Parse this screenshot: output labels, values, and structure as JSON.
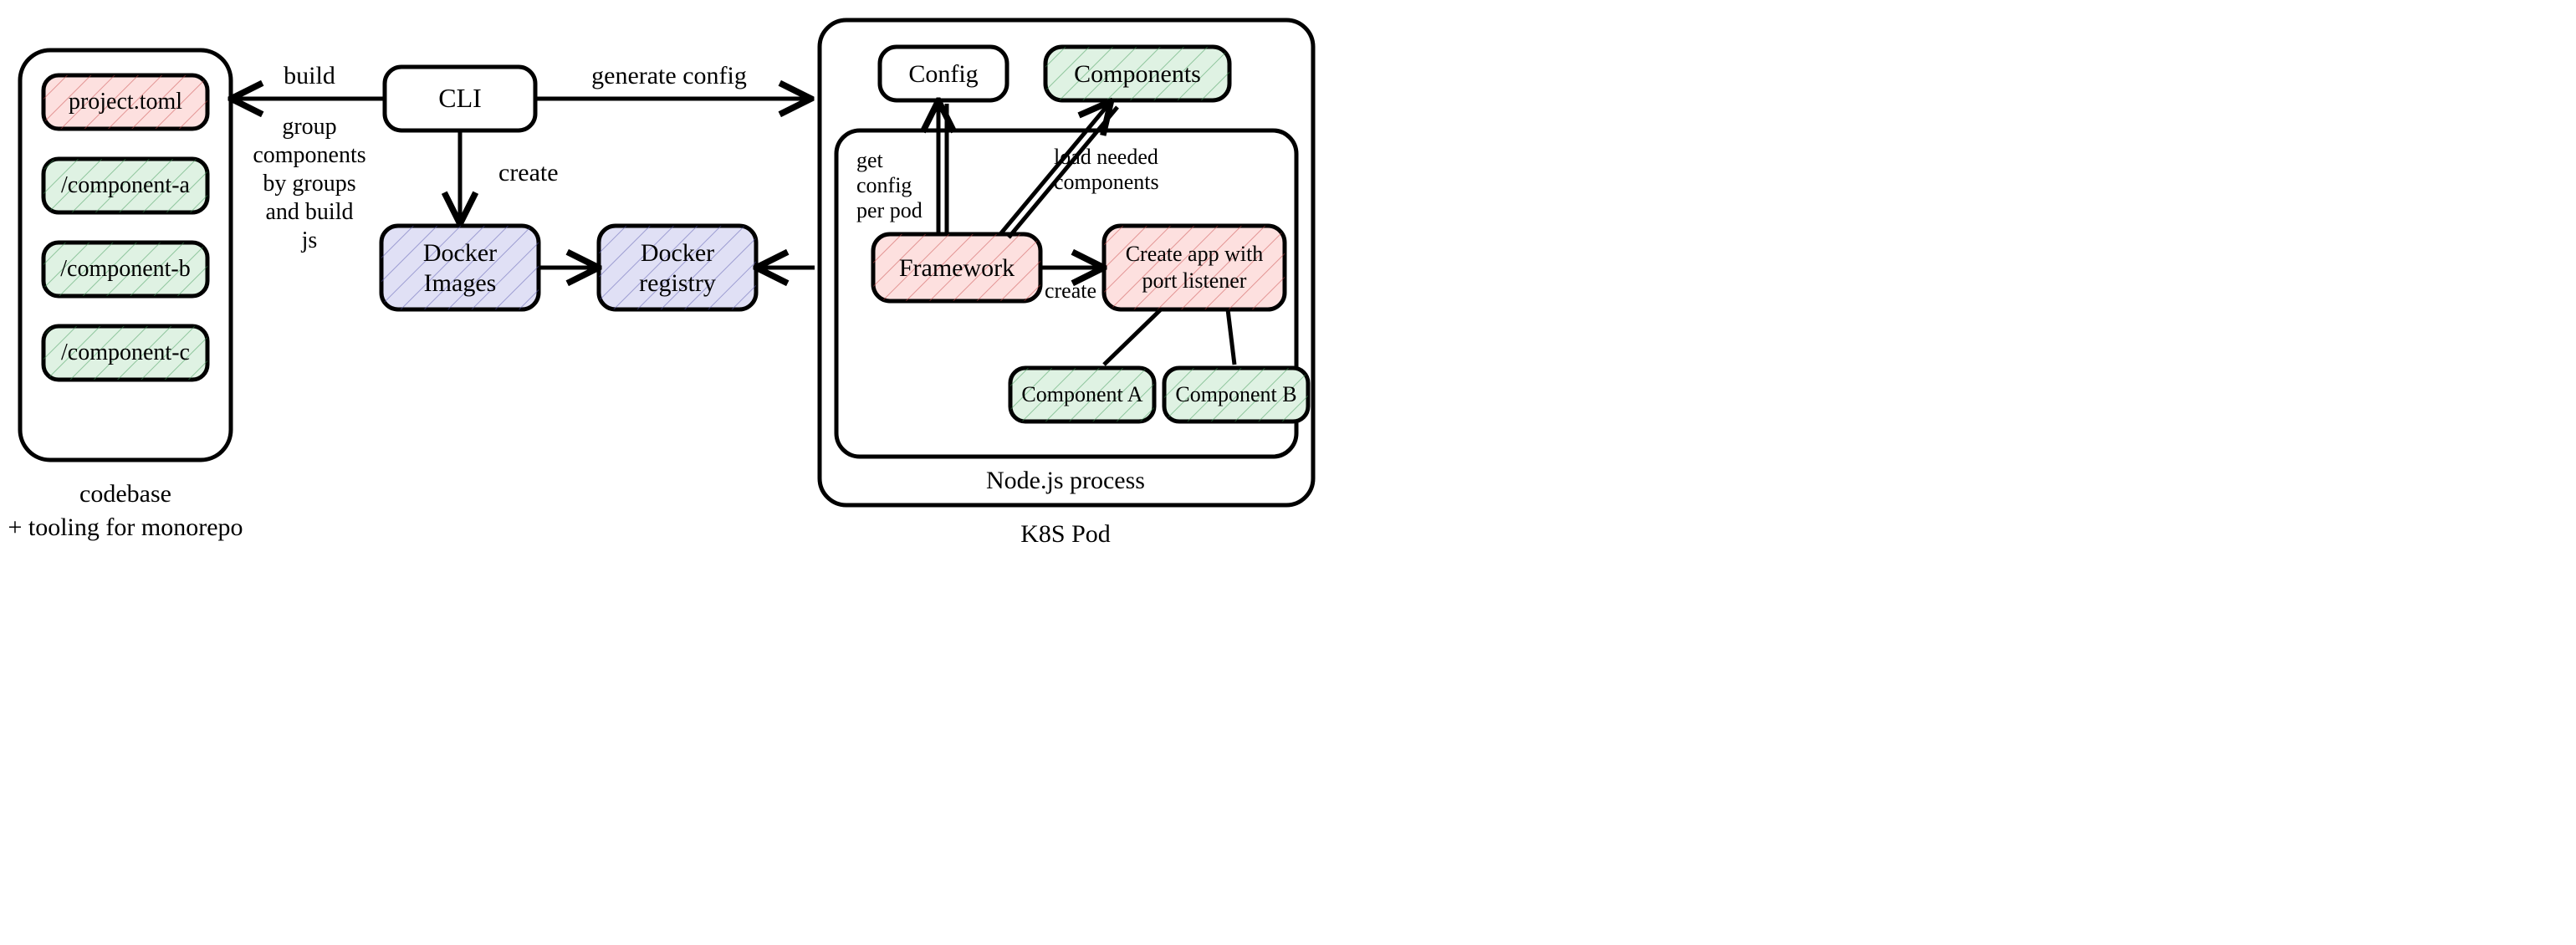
{
  "codebase": {
    "project_toml": "project.toml",
    "component_a": "/component-a",
    "component_b": "/component-b",
    "component_c": "/component-c",
    "caption_line1": "codebase",
    "caption_line2": "+ tooling for monorepo"
  },
  "cli": {
    "label": "CLI",
    "build_label": "build",
    "build_note_l1": "group",
    "build_note_l2": "components",
    "build_note_l3": "by groups",
    "build_note_l4": "and build",
    "build_note_l5": "js",
    "create_label": "create",
    "generate_config_label": "generate config"
  },
  "docker": {
    "images_l1": "Docker",
    "images_l2": "Images",
    "registry_l1": "Docker",
    "registry_l2": "registry"
  },
  "pod": {
    "caption": "K8S Pod",
    "process_caption": "Node.js process",
    "config": "Config",
    "components": "Components",
    "framework": "Framework",
    "create_app_l1": "Create app with",
    "create_app_l2": "port listener",
    "component_a": "Component A",
    "component_b": "Component B",
    "get_config_l1": "get",
    "get_config_l2": "config",
    "get_config_l3": "per pod",
    "load_needed_l1": "load needed",
    "load_needed_l2": "components",
    "create_label": "create"
  }
}
